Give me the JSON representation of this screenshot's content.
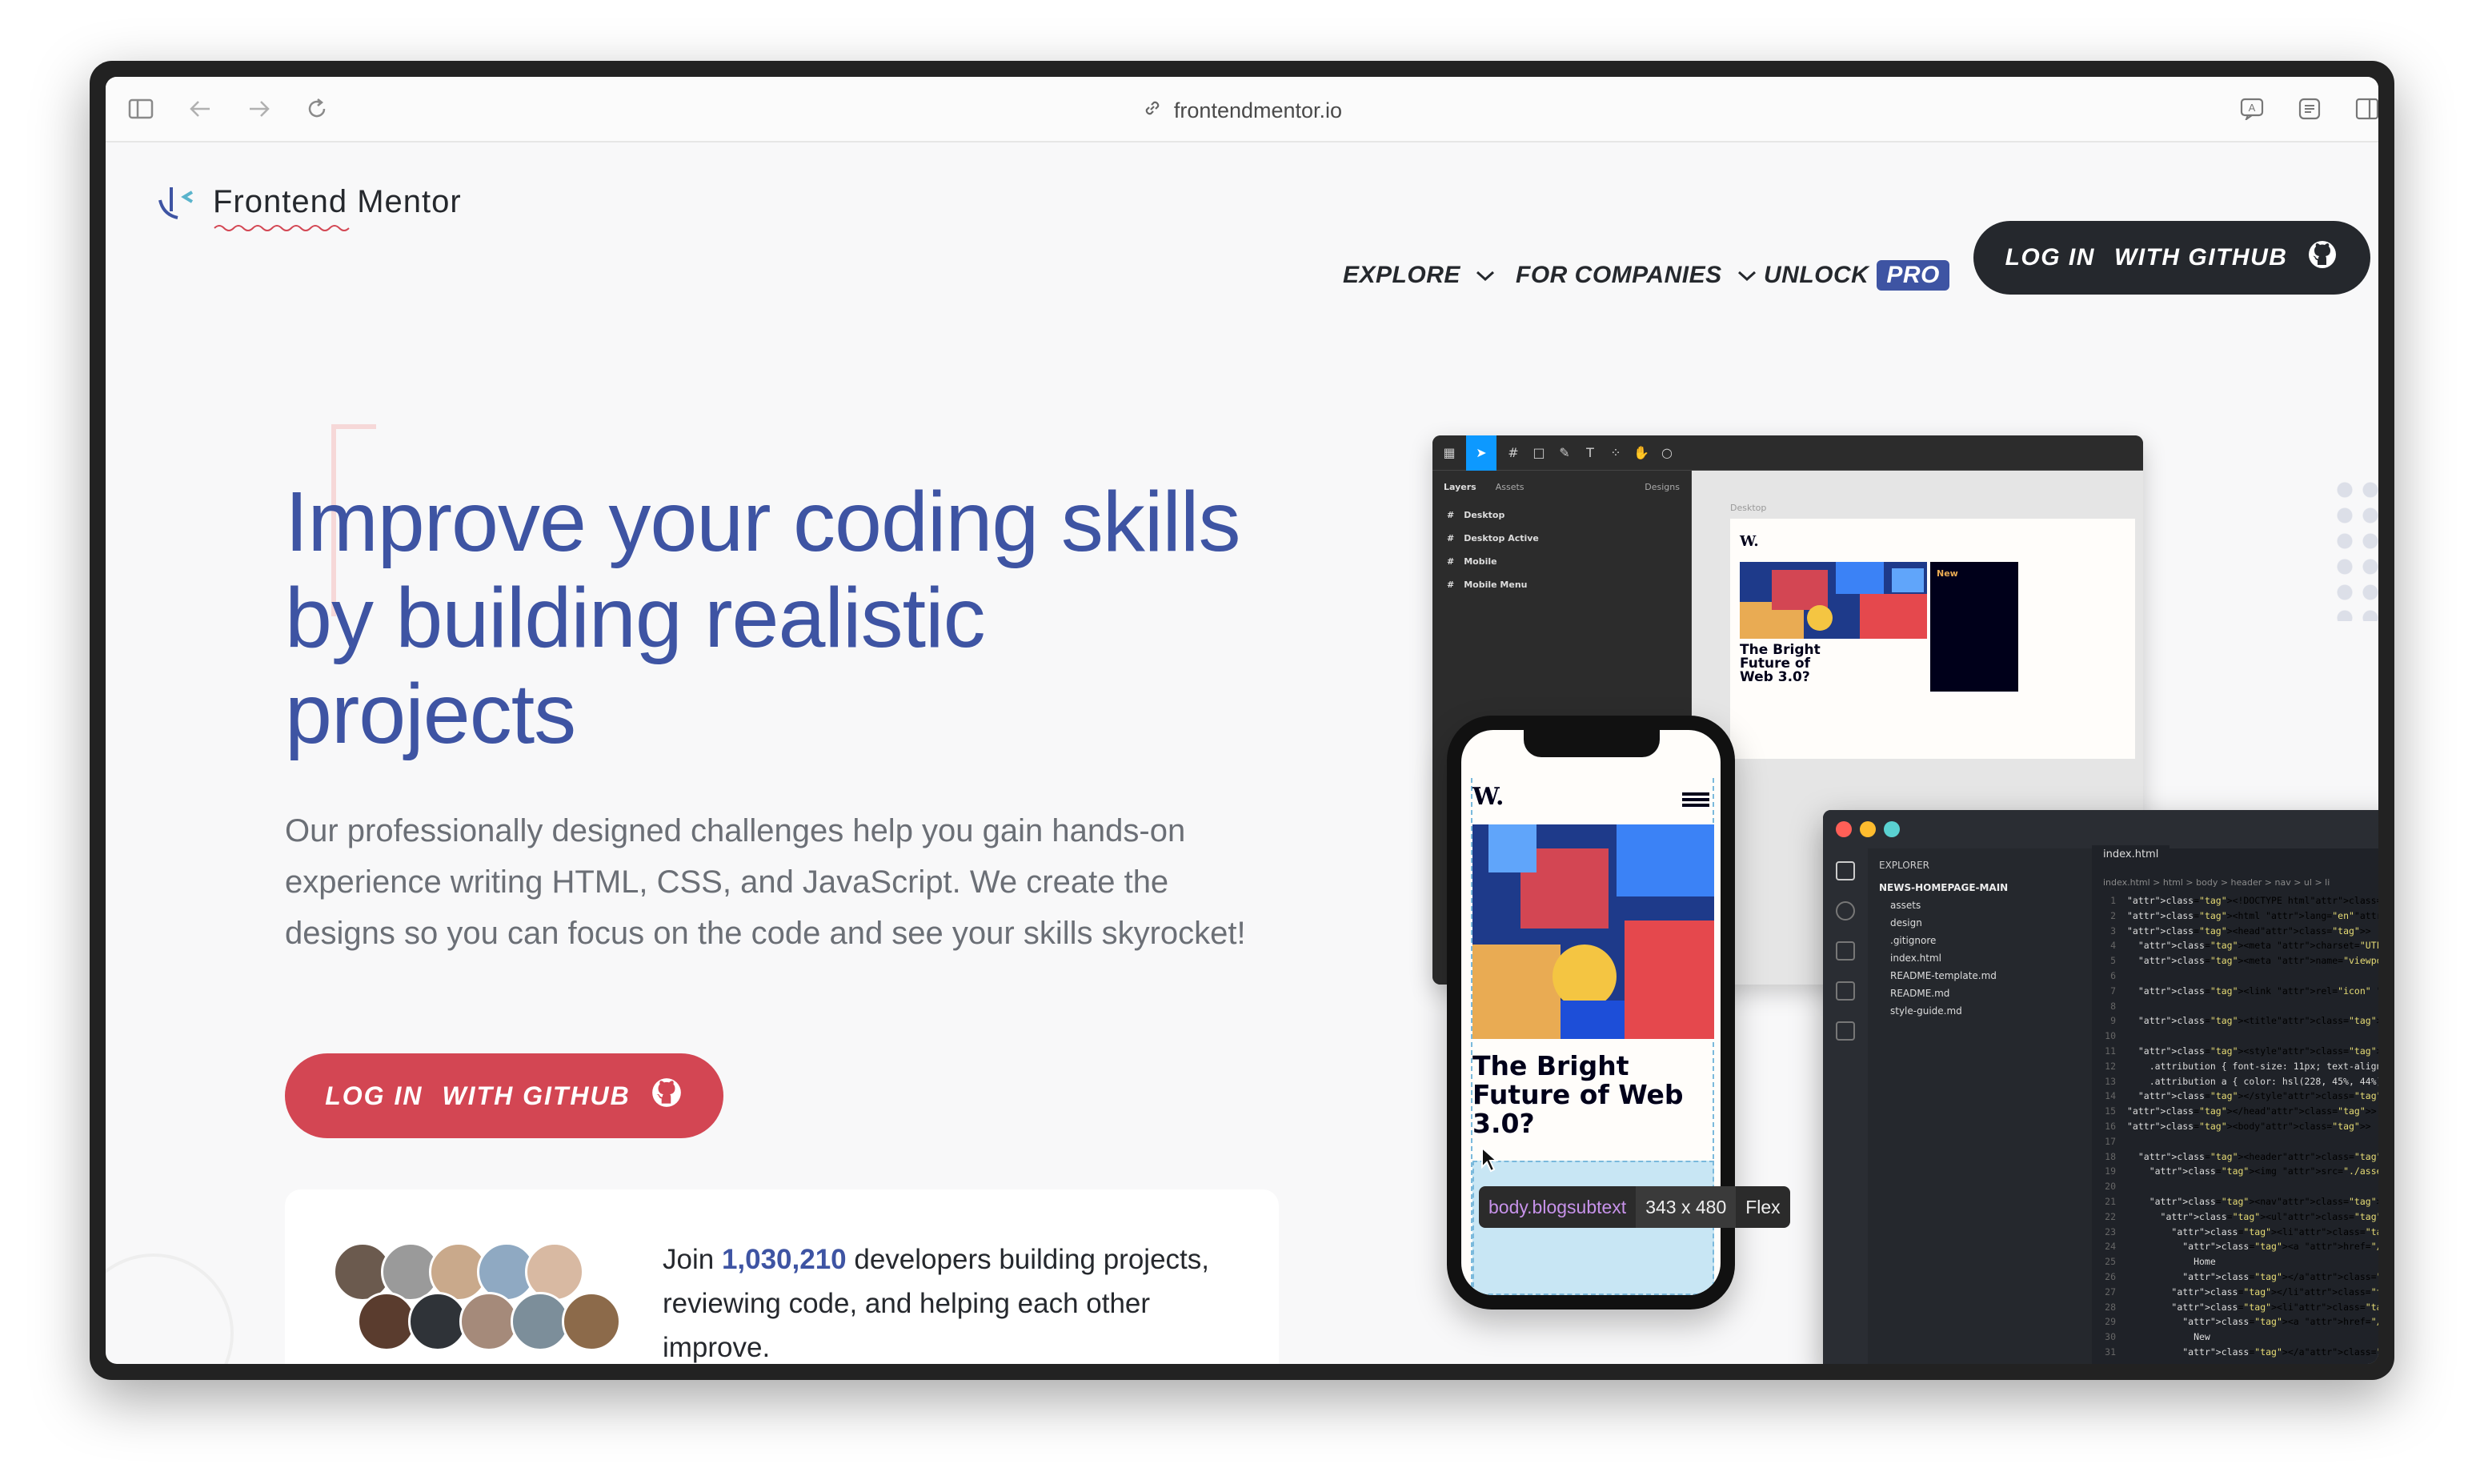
{
  "browser": {
    "url": "frontendmentor.io"
  },
  "header": {
    "logo_text": "Frontend Mentor",
    "nav": {
      "explore": "EXPLORE",
      "for_companies": "FOR COMPANIES",
      "unlock": "UNLOCK",
      "pro": "PRO"
    },
    "login_button": {
      "part1": "LOG IN",
      "part2": "WITH GITHUB"
    }
  },
  "hero": {
    "title_line1": "Improve your coding skills",
    "title_line2": "by building realistic",
    "title_line3": "projects",
    "subtitle": "Our professionally designed challenges help you gain hands-on experience writing HTML, CSS, and JavaScript. We create the designs so you can focus on the code and see your skills skyrocket!",
    "cta": {
      "part1": "LOG IN",
      "part2": "WITH GITHUB"
    }
  },
  "join": {
    "prefix": "Join ",
    "count": "1,030,210",
    "suffix": " developers building projects, reviewing code, and helping each other improve."
  },
  "figma": {
    "tabs": {
      "layers": "Layers",
      "assets": "Assets",
      "page": "Designs"
    },
    "layers": [
      "Desktop",
      "Desktop Active",
      "Mobile",
      "Mobile Menu"
    ],
    "canvas_label": "Desktop",
    "design": {
      "logo": "W.",
      "new_label": "New",
      "title": "The Bright Future of Web 3.0?"
    }
  },
  "vscode": {
    "explorer_label": "EXPLORER",
    "root": "NEWS-HOMEPAGE-MAIN",
    "files": [
      "assets",
      "design",
      ".gitignore",
      "index.html",
      "README-template.md",
      "README.md",
      "style-guide.md"
    ],
    "tab": "index.html",
    "breadcrumb": "index.html > html > body > header > nav > ul > li",
    "code": [
      "<!DOCTYPE html>",
      "<html lang=\"en\">",
      "<head>",
      "  <meta charset=\"UTF-8\">",
      "  <meta name=\"viewport\" content=\"width=device-width, initia",
      "",
      "  <link rel=\"icon\" type=\"image/png\" sizes=\"32x32\" href=\"./a",
      "",
      "  <title>Frontend Mentor | News homepage</title>",
      "",
      "  <style>",
      "    .attribution { font-size: 11px; text-align: center; }",
      "    .attribution a { color: hsl(228, 45%, 44%); }",
      "  </style>",
      "</head>",
      "<body>",
      "",
      "  <header>",
      "    <img src=\"./assets/images/logo.svg\" alt=\"News\" class=\"l",
      "",
      "    <nav>",
      "      <ul>",
      "        <li>",
      "          <a href=\"/\">",
      "            Home",
      "          </a>",
      "        </li>",
      "        <li>",
      "          <a href=\"/new\">",
      "            New",
      "          </a>"
    ]
  },
  "phone": {
    "logo": "W.",
    "title": "The Bright Future of Web 3.0?"
  },
  "tooltip": {
    "selector": "body.blogsubtext",
    "size": "343 x 480",
    "layout": "Flex"
  },
  "colors": {
    "brand_blue": "#3e54a3",
    "cta_red": "#d34653",
    "dark": "#25282d"
  }
}
